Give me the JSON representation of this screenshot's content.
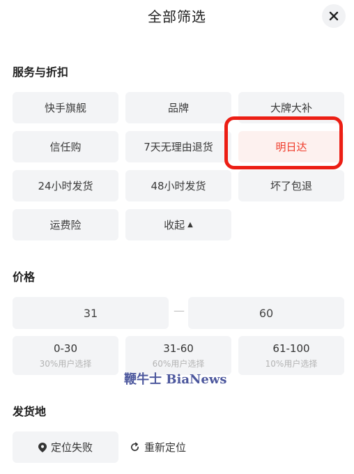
{
  "header": {
    "title": "全部筛选",
    "close_icon": "close-icon"
  },
  "services": {
    "title": "服务与折扣",
    "chips": [
      "快手旗舰",
      "品牌",
      "大牌大补",
      "信任购",
      "7天无理由退货",
      "明日达",
      "24小时发货",
      "48小时发货",
      "坏了包退",
      "运费险"
    ],
    "selected": "明日达",
    "collapse_label": "收起"
  },
  "price": {
    "title": "价格",
    "min_value": "31",
    "separator": "—",
    "max_value": "60",
    "ranges": [
      {
        "label": "0-30",
        "sub": "30%用户选择"
      },
      {
        "label": "31-60",
        "sub": "60%用户选择"
      },
      {
        "label": "61-100",
        "sub": "10%用户选择"
      }
    ]
  },
  "shipping": {
    "title": "发货地",
    "location_label": "定位失败",
    "relocate_label": "重新定位"
  },
  "watermark": "鞭牛士 BiaNews",
  "colors": {
    "accent": "#ef3b2a",
    "highlight_border": "#ec1e14",
    "chip_bg": "#f3f4f6"
  }
}
